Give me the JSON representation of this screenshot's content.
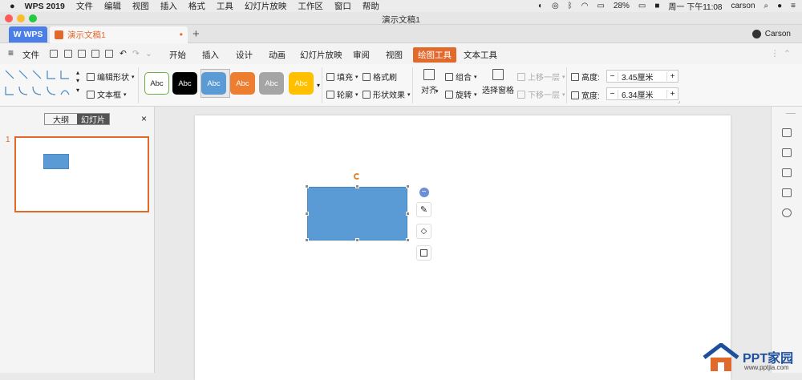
{
  "menubar": {
    "apple": "",
    "app_name": "WPS 2019",
    "items": [
      "文件",
      "编辑",
      "视图",
      "插入",
      "格式",
      "工具",
      "幻灯片放映",
      "工作区",
      "窗口",
      "帮助"
    ],
    "battery": "28%",
    "datetime": "周一 下午11:08",
    "user": "carson"
  },
  "window": {
    "title": "演示文稿1"
  },
  "tabs": {
    "wps_label": "WPS",
    "doc_label": "演示文稿1",
    "new_tab": "+",
    "user_name": "Carson"
  },
  "ribbon_tabs": {
    "file": "文件",
    "items": [
      "开始",
      "插入",
      "设计",
      "动画",
      "幻灯片放映",
      "审阅",
      "视图",
      "绘图工具",
      "文本工具"
    ],
    "active_index": 7
  },
  "ribbon": {
    "edit_shape": "编辑形状",
    "text_box": "文本框",
    "styles": [
      {
        "label": "Abc",
        "bg": "#ffffff",
        "fg": "#222222",
        "border": "#70ad47"
      },
      {
        "label": "Abc",
        "bg": "#000000",
        "fg": "#ffffff",
        "border": "#000000"
      },
      {
        "label": "Abc",
        "bg": "#5b9bd5",
        "fg": "#ffffff",
        "border": "#5b9bd5"
      },
      {
        "label": "Abc",
        "bg": "#ed7d31",
        "fg": "#ffffff",
        "border": "#ed7d31"
      },
      {
        "label": "Abc",
        "bg": "#a5a5a5",
        "fg": "#ffffff",
        "border": "#a5a5a5"
      },
      {
        "label": "Abc",
        "bg": "#ffc000",
        "fg": "#ffffff",
        "border": "#ffc000"
      }
    ],
    "fill": "填充",
    "format_painter": "格式刷",
    "outline": "轮廓",
    "shape_effects": "形状效果",
    "align": "对齐",
    "group": "组合",
    "rotate": "旋转",
    "selection_pane": "选择窗格",
    "bring_forward": "上移一层",
    "send_backward": "下移一层",
    "height_label": "高度:",
    "height_value": "3.45厘米",
    "width_label": "宽度:",
    "width_value": "6.34厘米"
  },
  "left_panel": {
    "outline_tab": "大纲",
    "slides_tab": "幻灯片",
    "close": "×",
    "slide_number": "1"
  },
  "shape": {
    "color": "#5b9bd5"
  },
  "watermark": {
    "brand": "PPT家园",
    "url": "www.pptjia.com"
  }
}
